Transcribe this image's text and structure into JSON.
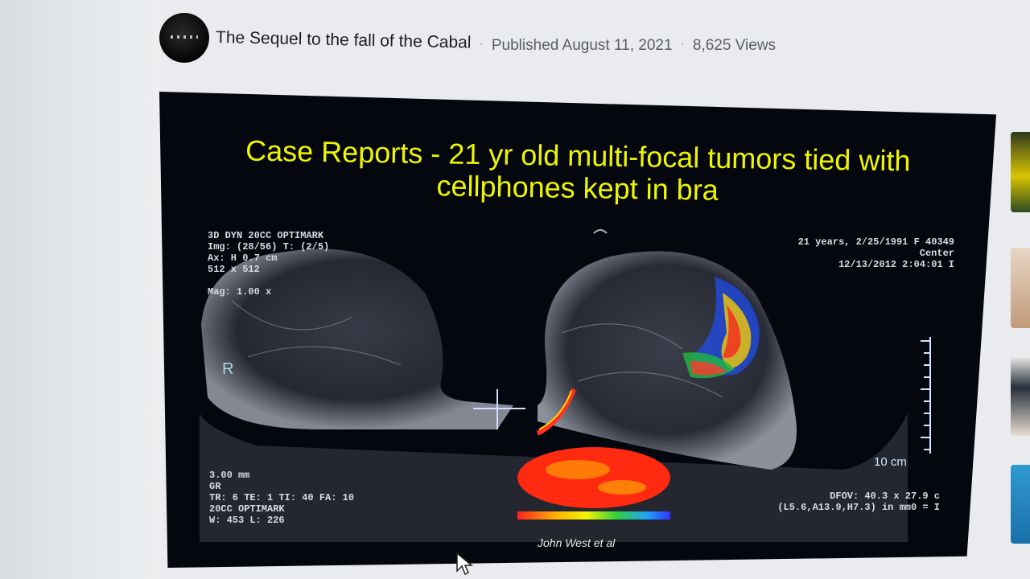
{
  "post": {
    "channel_name": "The Sequel to the fall of the Cabal",
    "separator": "·",
    "published": "Published August 11, 2021",
    "views": "8,625 Views"
  },
  "slide": {
    "title_line1": "Case Reports - 21 yr old multi-focal tumors tied with",
    "title_line2": "cellphones kept in bra",
    "top_left": [
      "3D DYN 20CC OPTIMARK",
      "Img: (28/56) T: (2/5)",
      "Ax: H     0.7 cm",
      "512 x 512"
    ],
    "mag": "Mag: 1.00 x",
    "side_marker": "R",
    "top_right": [
      "21 years, 2/25/1991 F 40349",
      "Center",
      "12/13/2012 2:04:01 I"
    ],
    "bottom_left": [
      "3.00 mm",
      "GR",
      "TR: 6 TE: 1 TI: 40 FA: 10",
      "20CC  OPTIMARK",
      "W: 453 L: 226"
    ],
    "bottom_right": [
      "DFOV: 40.3 x 27.9 c",
      "(L5.6,A13.9,H7.3) in mm0 = I"
    ],
    "scale_label": "10 cm",
    "author": "John West et al"
  },
  "colors": {
    "title_yellow": "#eef500",
    "frame_bg": "#05070f",
    "page_bg": "#e9ebee"
  }
}
